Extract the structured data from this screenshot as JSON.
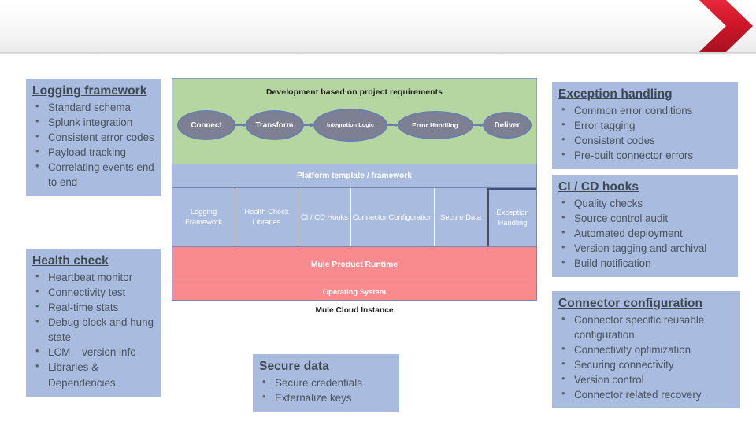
{
  "header": {
    "chevron_color": "#d01729",
    "band_note": ""
  },
  "theme": {
    "callout_bg": "#a9bbdf",
    "callout_title_color": "#3d4852",
    "green_panel": "#b5d6a0",
    "blue_panel": "#a9bbdf",
    "red_panel": "#f98a8e",
    "node_fill": "#7d7f93",
    "node_border": "#6b7fae",
    "highlight_border": "#3e4f86"
  },
  "callouts": {
    "logging": {
      "title": "Logging framework",
      "items": [
        "Standard schema",
        "Splunk integration",
        "Consistent error codes",
        "Payload tracking",
        "Correlating events end to end"
      ]
    },
    "health_check": {
      "title": "Health check",
      "items": [
        "Heartbeat monitor",
        "Connectivity test",
        "Real-time stats",
        "Debug block and hung state",
        "LCM – version info",
        "Libraries & Dependencies"
      ]
    },
    "exception": {
      "title": "Exception handling",
      "items": [
        "Common error conditions",
        "Error tagging",
        "Consistent codes",
        "Pre-built connector errors"
      ]
    },
    "cicd": {
      "title": "CI / CD hooks",
      "items": [
        "Quality checks",
        "Source control audit",
        "Automated deployment",
        "Version tagging and archival",
        "Build notification"
      ]
    },
    "connector": {
      "title": "Connector configuration",
      "items": [
        "Connector specific reusable configuration",
        "Connectivity optimization",
        "Securing connectivity",
        "Version control",
        "Connector related recovery"
      ]
    },
    "secure_data": {
      "title": "Secure data",
      "items": [
        "Secure credentials",
        "Externalize keys"
      ]
    }
  },
  "diagram": {
    "development_title": "Development based on project requirements",
    "flow_nodes": [
      "Connect",
      "Transform",
      "Integration Logic",
      "Error Handling",
      "Deliver"
    ],
    "platform_title": "Platform template / framework",
    "platform_cells": [
      "Logging Framework",
      "Health Check Libraries",
      "CI / CD Hooks",
      "Connector Configuration",
      "Secure Data",
      "Exception Handling"
    ],
    "runtime_label": "Mule Product Runtime",
    "os_label": "Operating System",
    "caption": "Mule Cloud Instance"
  }
}
